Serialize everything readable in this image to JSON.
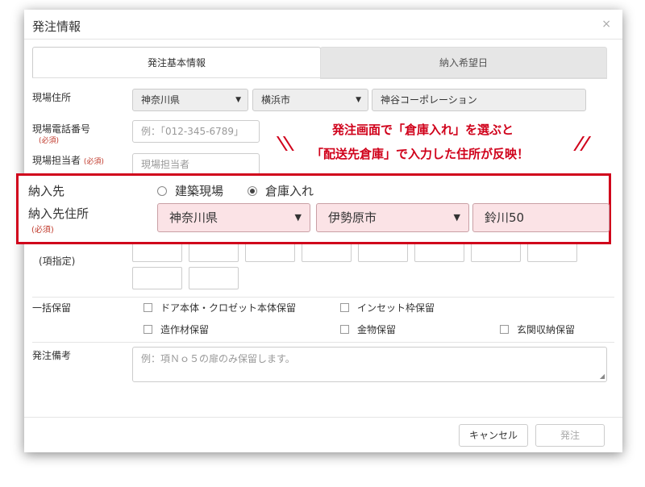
{
  "dialog": {
    "title": "発注情報",
    "close": "×"
  },
  "tabs": [
    {
      "label": "発注基本情報"
    },
    {
      "label": "納入希望日"
    }
  ],
  "site_address": {
    "label": "現場住所",
    "prefecture": "神奈川県",
    "city": "横浜市",
    "company": "神谷コーポレーション"
  },
  "site_phone": {
    "label": "現場電話番号",
    "required": "(必須)",
    "placeholder": "例：「012-345-6789」"
  },
  "site_manager": {
    "label": "現場担当者",
    "required": "(必須)",
    "placeholder": "現場担当者"
  },
  "location_label": "(項指定)",
  "hold_all": {
    "label": "一括保留",
    "options": [
      "ドア本体・クロゼット本体保留",
      "インセット枠保留",
      "造作材保留",
      "金物保留",
      "玄関収納保留"
    ]
  },
  "notes": {
    "label": "発注備考",
    "placeholder": "例：項Ｎｏ５の扉のみ保留します。"
  },
  "buttons": {
    "cancel": "キャンセル",
    "order": "発注"
  },
  "callout": {
    "delivery_label": "納入先",
    "radio_site": "建築現場",
    "radio_warehouse": "倉庫入れ",
    "address_label": "納入先住所",
    "required": "(必須)",
    "prefecture": "神奈川県",
    "city": "伊勢原市",
    "street": "鈴川50"
  },
  "annotation": {
    "line1": "発注画面で「倉庫入れ」を選ぶと",
    "line2": "「配送先倉庫」で入力した住所が反映！"
  },
  "colors": {
    "highlight": "#d0021b",
    "pink_field": "#fbe3e6"
  }
}
